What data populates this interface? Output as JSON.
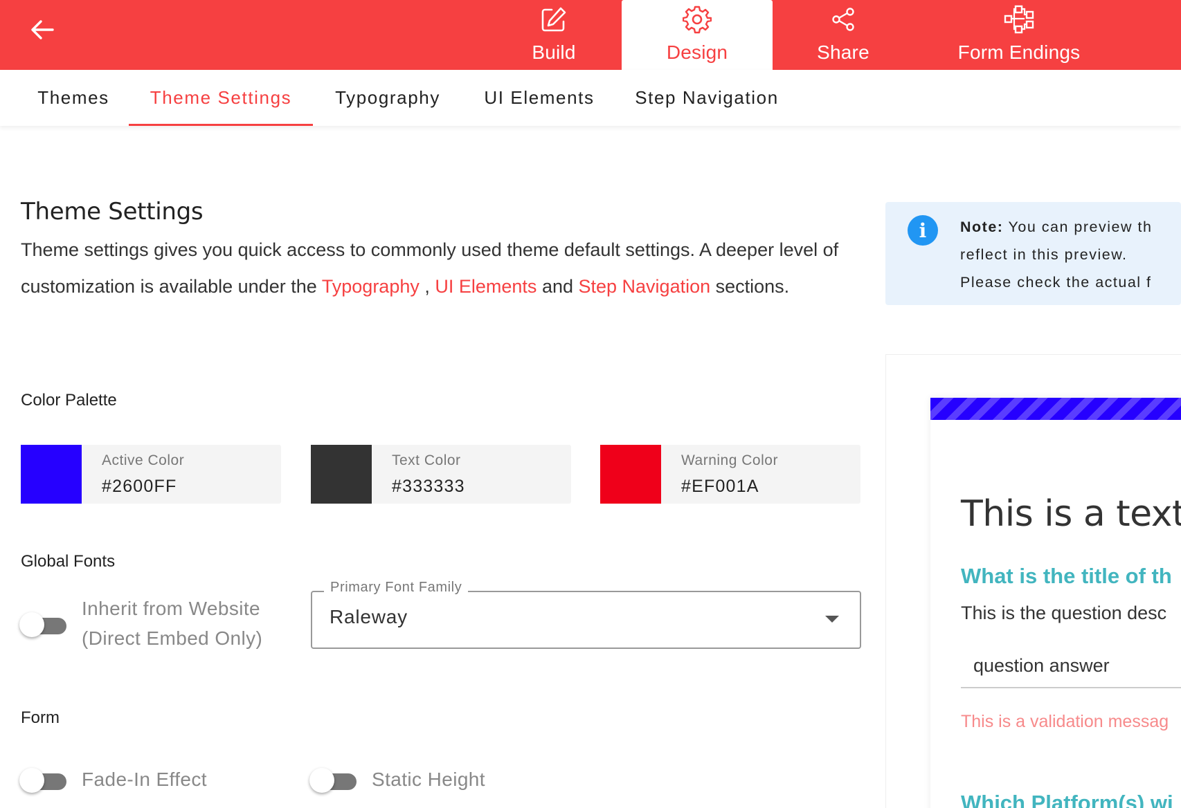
{
  "colors": {
    "brand": "#f64041",
    "active": "#2600FF",
    "text": "#333333",
    "warning": "#EF001A",
    "preview_accent": "#42b5bf",
    "info": "#2196f3"
  },
  "topbar": {
    "back_icon": "arrow-left-icon",
    "tabs": [
      {
        "label": "Build",
        "icon": "edit-icon",
        "active": false
      },
      {
        "label": "Design",
        "icon": "gear-icon",
        "active": true
      },
      {
        "label": "Share",
        "icon": "share-icon",
        "active": false
      },
      {
        "label": "Form Endings",
        "icon": "flow-icon",
        "active": false
      }
    ]
  },
  "subnav": {
    "tabs": [
      {
        "label": "Themes",
        "active": false
      },
      {
        "label": "Theme Settings",
        "active": true
      },
      {
        "label": "Typography",
        "active": false
      },
      {
        "label": "UI Elements",
        "active": false
      },
      {
        "label": "Step Navigation",
        "active": false
      }
    ]
  },
  "settings": {
    "title": "Theme Settings",
    "description": {
      "part1": "Theme settings gives you quick access to commonly used theme default settings. A deeper level of customization is available under the ",
      "link1": "Typography",
      "sep1": " , ",
      "link2": "UI Elements",
      "sep2": " and ",
      "link3": "Step Navigation",
      "part2": " sections."
    },
    "color_palette": {
      "label": "Color Palette",
      "swatches": [
        {
          "name": "Active Color",
          "hex": "#2600FF"
        },
        {
          "name": "Text Color",
          "hex": "#333333"
        },
        {
          "name": "Warning Color",
          "hex": "#EF001A"
        }
      ]
    },
    "global_fonts": {
      "label": "Global Fonts",
      "inherit_toggle": {
        "label_line1": "Inherit from Website",
        "label_line2": "(Direct Embed Only)",
        "on": false
      },
      "primary_font": {
        "legend": "Primary Font Family",
        "value": "Raleway"
      }
    },
    "form": {
      "label": "Form",
      "fade_toggle": {
        "label": "Fade-In Effect",
        "on": false
      },
      "static_toggle": {
        "label": "Static Height",
        "on": false
      }
    }
  },
  "note": {
    "prefix": "Note:",
    "line1": " You can preview th",
    "line2": "reflect in this preview.",
    "line3": "Please check the actual f"
  },
  "preview": {
    "heading": "This is a text",
    "question1": "What is the title of th",
    "question_desc": "This is the question desc",
    "answer": "question answer",
    "validation": "This is a validation messag",
    "question2": "Which Platform(s) wi"
  }
}
